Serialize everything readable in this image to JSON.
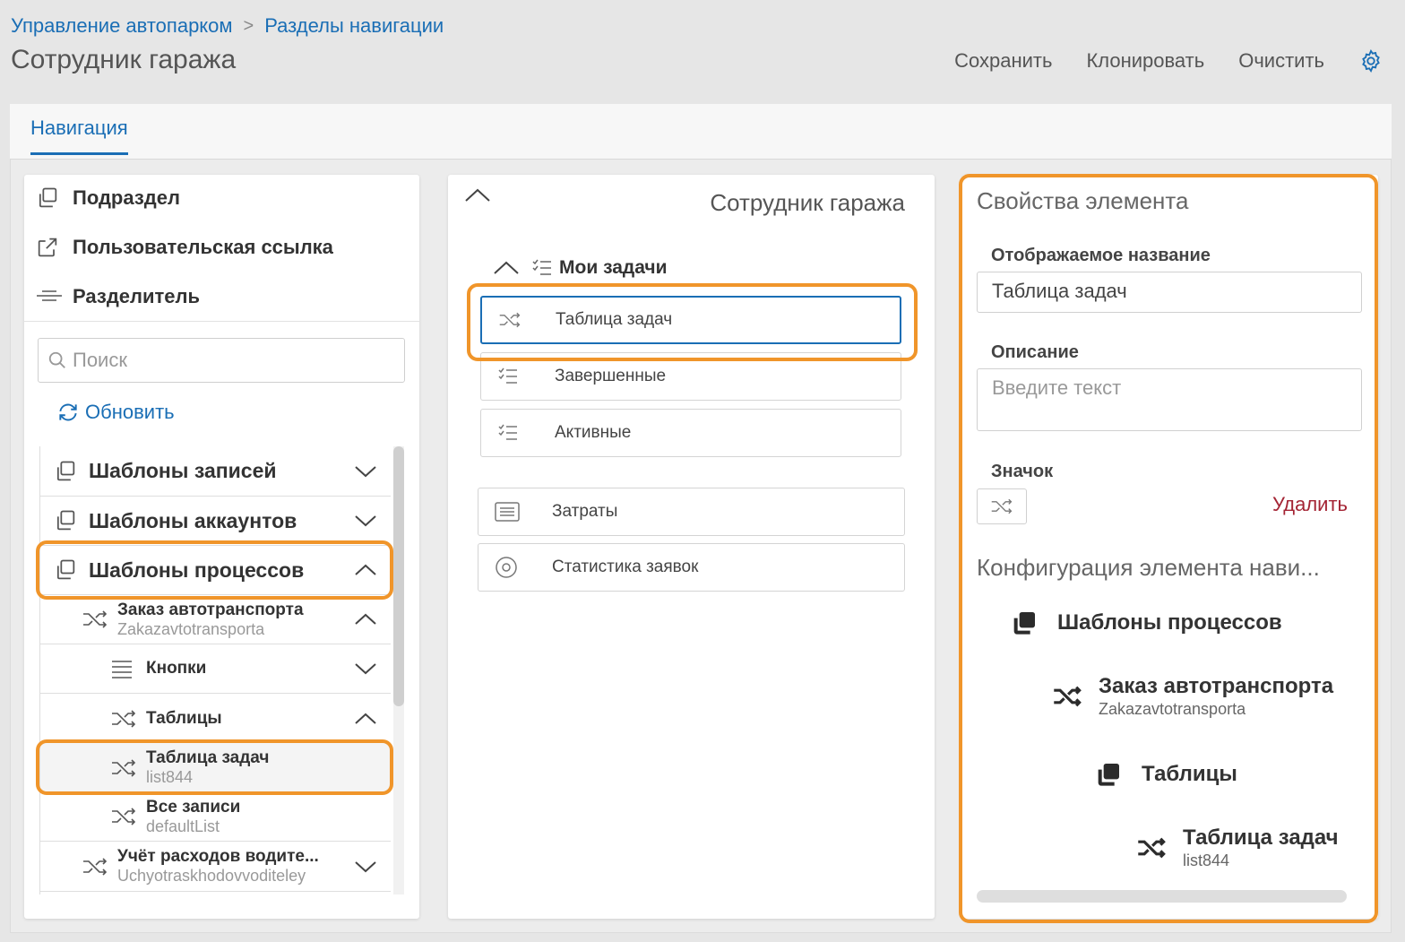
{
  "breadcrumb": {
    "parent": "Управление автопарком",
    "separator": ">",
    "current": "Разделы навигации"
  },
  "page_title": "Сотрудник гаража",
  "actions": {
    "save": "Сохранить",
    "clone": "Клонировать",
    "clear": "Очистить"
  },
  "tabs": {
    "navigation": "Навигация"
  },
  "left": {
    "tools": {
      "subsection": "Подраздел",
      "custom_link": "Пользовательская ссылка",
      "separator": "Разделитель"
    },
    "search_placeholder": "Поиск",
    "refresh": "Обновить",
    "tree": {
      "record_templates": "Шаблоны записей",
      "account_templates": "Шаблоны аккаунтов",
      "process_templates": "Шаблоны процессов",
      "transport_order": {
        "title": "Заказ автотранспорта",
        "code": "Zakazavtotransporta"
      },
      "buttons": "Кнопки",
      "tables": "Таблицы",
      "task_table": {
        "title": "Таблица задач",
        "code": "list844"
      },
      "all_records": {
        "title": "Все записи",
        "code": "defaultList"
      },
      "expenses": {
        "title": "Учёт расходов водите...",
        "code": "Uchyotraskhodovvoditeley"
      }
    }
  },
  "middle": {
    "title": "Сотрудник гаража",
    "group": "Мои задачи",
    "items": {
      "task_table": "Таблица задач",
      "completed": "Завершенные",
      "active": "Активные",
      "costs": "Затраты",
      "stats": "Статистика заявок"
    }
  },
  "right": {
    "title": "Свойства элемента",
    "display_name_label": "Отображаемое название",
    "display_name_value": "Таблица задач",
    "description_label": "Описание",
    "description_placeholder": "Введите текст",
    "icon_label": "Значок",
    "delete": "Удалить",
    "config_title": "Конфигурация элемента нави...",
    "config": {
      "level1": "Шаблоны процессов",
      "level2": {
        "title": "Заказ автотранспорта",
        "code": "Zakazavtotransporta"
      },
      "level3": "Таблицы",
      "level4": {
        "title": "Таблица задач",
        "code": "list844"
      }
    }
  },
  "colors": {
    "accent": "#1a6eb5",
    "highlight": "#f0952a",
    "danger": "#a42434"
  }
}
